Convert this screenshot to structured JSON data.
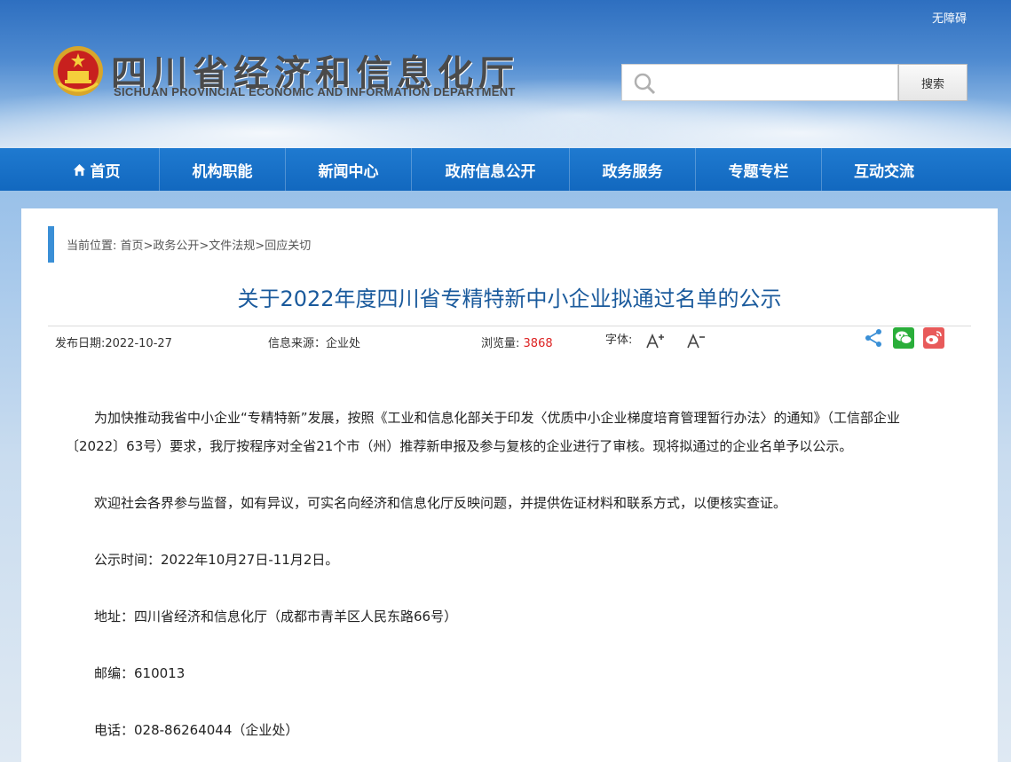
{
  "header": {
    "accessibility_label": "无障碍",
    "site_title": "四川省经济和信息化厅",
    "site_subtitle": "SICHUAN PROVINCIAL ECONOMIC AND INFORMATION DEPARTMENT",
    "search_placeholder": "",
    "search_button": "搜索"
  },
  "nav": {
    "items": [
      {
        "label": "首页"
      },
      {
        "label": "机构职能"
      },
      {
        "label": "新闻中心"
      },
      {
        "label": "政府信息公开"
      },
      {
        "label": "政务服务"
      },
      {
        "label": "专题专栏"
      },
      {
        "label": "互动交流"
      }
    ]
  },
  "breadcrumb": {
    "text": "当前位置: 首页>政务公开>文件法规>回应关切"
  },
  "article": {
    "title": "关于2022年度四川省专精特新中小企业拟通过名单的公示",
    "meta": {
      "date_label": "发布日期:",
      "date": "2022-10-27",
      "source_label": "信息来源：",
      "source": "企业处",
      "views_label": "浏览量:",
      "views": "3868",
      "font_label": "字体:"
    },
    "paragraphs": [
      "为加快推动我省中小企业“专精特新”发展，按照《工业和信息化部关于印发〈优质中小企业梯度培育管理暂行办法〉的通知》（工信部企业〔2022〕63号）要求，我厅按程序对全省21个市（州）推荐新申报及参与复核的企业进行了审核。现将拟通过的企业名单予以公示。",
      "欢迎社会各界参与监督，如有异议，可实名向经济和信息化厅反映问题，并提供佐证材料和联系方式，以便核实查证。",
      "公示时间：2022年10月27日-11月2日。",
      "地址：四川省经济和信息化厅（成都市青羊区人民东路66号）",
      "邮编：610013",
      "电话：028-86264044（企业处）"
    ]
  },
  "colors": {
    "nav_bg": "#1268bf",
    "title_color": "#1a5a9c",
    "views_color": "#dd2222",
    "wechat": "#2aae3a",
    "weibo": "#e85a5a"
  }
}
